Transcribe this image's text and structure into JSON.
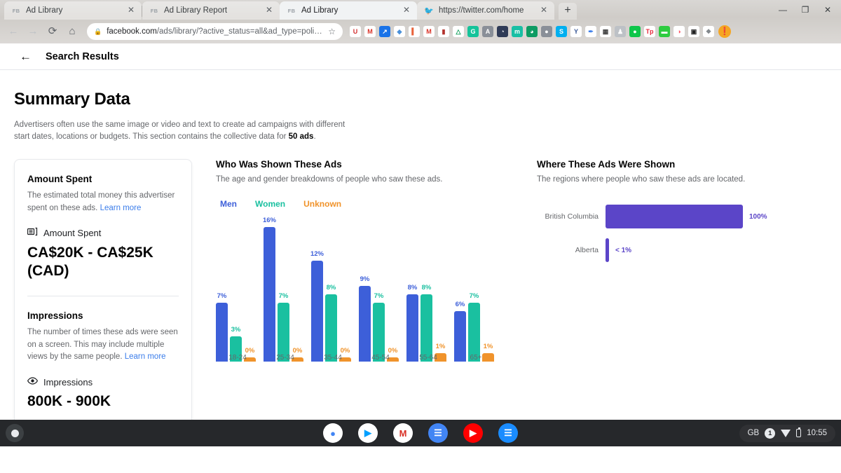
{
  "browser": {
    "tabs": [
      {
        "favicon": "fb-icon",
        "title": "Ad Library",
        "active": false
      },
      {
        "favicon": "fb-icon",
        "title": "Ad Library Report",
        "active": false
      },
      {
        "favicon": "fb-icon",
        "title": "Ad Library",
        "active": true
      },
      {
        "favicon": "twitter-icon",
        "title": "https://twitter.com/home",
        "active": false
      }
    ],
    "new_tab_label": "+",
    "close_label": "✕",
    "window_controls": [
      "—",
      "❐",
      "✕"
    ],
    "nav": {
      "back": "←",
      "forward": "→",
      "reload": "⟳",
      "home": "⌂"
    },
    "omnibox": {
      "lock": "🔒",
      "url_domain": "facebook.com",
      "url_path": "/ads/library/?active_status=all&ad_type=politic…",
      "star": "☆"
    },
    "bookmarks": [
      {
        "name": "magnet-icon",
        "glyph": "U",
        "bg": "#ffffff",
        "fg": "#d32f2f"
      },
      {
        "name": "gmail-alt-icon",
        "glyph": "M",
        "bg": "#ffffff",
        "fg": "#d93025"
      },
      {
        "name": "blue-arrow-icon",
        "glyph": "↗",
        "bg": "#1a73e8",
        "fg": "#ffffff"
      },
      {
        "name": "diamond-icon",
        "glyph": "◆",
        "bg": "#ffffff",
        "fg": "#4a90d9"
      },
      {
        "name": "red-book-icon",
        "glyph": "▍",
        "bg": "#ffffff",
        "fg": "#e8623a"
      },
      {
        "name": "gmail-icon",
        "glyph": "M",
        "bg": "#ffffff",
        "fg": "#d93025"
      },
      {
        "name": "dictionary-icon",
        "glyph": "▮",
        "bg": "#ffffff",
        "fg": "#b3322c"
      },
      {
        "name": "google-drive-icon",
        "glyph": "△",
        "bg": "#ffffff",
        "fg": "#0f9d58"
      },
      {
        "name": "grammarly-icon",
        "glyph": "G",
        "bg": "#15c39a",
        "fg": "#ffffff"
      },
      {
        "name": "archive-icon",
        "glyph": "A",
        "bg": "#8a8f98",
        "fg": "#ffffff"
      },
      {
        "name": "moon-icon",
        "glyph": "◔",
        "bg": "#2f3a56",
        "fg": "#ffffff"
      },
      {
        "name": "mix-icon",
        "glyph": "m",
        "bg": "#18bfa4",
        "fg": "#ffffff"
      },
      {
        "name": "clock-icon",
        "glyph": "◕",
        "bg": "#0d9b63",
        "fg": "#ffffff"
      },
      {
        "name": "ghostery-icon",
        "glyph": "●",
        "bg": "#8a8f98",
        "fg": "#ffffff"
      },
      {
        "name": "skype-icon",
        "glyph": "S",
        "bg": "#00aff0",
        "fg": "#ffffff"
      },
      {
        "name": "yandex-icon",
        "glyph": "Y",
        "bg": "#ffffff",
        "fg": "#3b5998"
      },
      {
        "name": "eyedropper-icon",
        "glyph": "✒",
        "bg": "#ffffff",
        "fg": "#3b7dea"
      },
      {
        "name": "news-icon",
        "glyph": "▦",
        "bg": "#ffffff",
        "fg": "#444444"
      },
      {
        "name": "walk-icon",
        "glyph": "♟",
        "bg": "#bdc1c6",
        "fg": "#ffffff"
      },
      {
        "name": "flame-icon",
        "glyph": "●",
        "bg": "#0ec64a",
        "fg": "#ffffff"
      },
      {
        "name": "toronto-star-icon",
        "glyph": "Tp",
        "bg": "#ffffff",
        "fg": "#e8253a"
      },
      {
        "name": "pill-icon",
        "glyph": "▬",
        "bg": "#2ecc40",
        "fg": "#ffffff"
      },
      {
        "name": "ad-icon",
        "glyph": "◑",
        "bg": "#ffffff",
        "fg": "#ff5566"
      },
      {
        "name": "pip-icon",
        "glyph": "▣",
        "bg": "#ffffff",
        "fg": "#222222"
      },
      {
        "name": "extensions-icon",
        "glyph": "❖",
        "bg": "#ffffff",
        "fg": "#80868b"
      }
    ],
    "profile_initial": "❗"
  },
  "page_header": {
    "back_label": "←",
    "title": "Search Results"
  },
  "summary": {
    "title": "Summary Data",
    "description_part1": "Advertisers often use the same image or video and text to create ad campaigns with different start dates, locations or budgets. This section contains the collective data for ",
    "ads_count": "50 ads",
    "description_part2": "."
  },
  "amount_card": {
    "heading": "Amount Spent",
    "description": "The estimated total money this advertiser spent on these ads.",
    "learn_more": "Learn more",
    "metric_icon": "money-stack-icon",
    "metric_name": "Amount Spent",
    "metric_value": "CA$20K - CA$25K (CAD)",
    "impressions_heading": "Impressions",
    "impressions_description": "The number of times these ads were seen on a screen. This may include multiple views by the same people.",
    "impressions_learn_more": "Learn more",
    "impressions_icon": "eye-icon",
    "impressions_metric_name": "Impressions",
    "impressions_value": "800K - 900K"
  },
  "gender_panel": {
    "heading": "Who Was Shown These Ads",
    "subheading": "The age and gender breakdowns of people who saw these ads."
  },
  "region_panel": {
    "heading": "Where These Ads Were Shown",
    "subheading": "The regions where people who saw these ads are located."
  },
  "colors": {
    "men": "#3d5fd9",
    "women": "#1ac0a0",
    "unknown": "#f0932b",
    "region": "#5b45c8",
    "link": "#3b7dea"
  },
  "chart_data": [
    {
      "type": "bar",
      "title": "Who Was Shown These Ads",
      "subtitle": "The age and gender breakdowns of people who saw these ads.",
      "xlabel": "",
      "ylabel": "",
      "ylim": [
        0,
        16
      ],
      "grid": false,
      "legend_position": "top-left",
      "categories": [
        "18-24",
        "25-34",
        "35-44",
        "45-54",
        "55-64",
        "65+"
      ],
      "series": [
        {
          "name": "Men",
          "color": "#3d5fd9",
          "values": [
            7,
            16,
            12,
            9,
            8,
            6
          ],
          "labels": [
            "7%",
            "16%",
            "12%",
            "9%",
            "8%",
            "6%"
          ]
        },
        {
          "name": "Women",
          "color": "#1ac0a0",
          "values": [
            3,
            7,
            8,
            7,
            8,
            7
          ],
          "labels": [
            "3%",
            "7%",
            "8%",
            "7%",
            "8%",
            "7%"
          ]
        },
        {
          "name": "Unknown",
          "color": "#f0932b",
          "values": [
            0,
            0,
            0,
            0,
            1,
            1
          ],
          "labels": [
            "0%",
            "0%",
            "0%",
            "0%",
            "1%",
            "1%"
          ]
        }
      ]
    },
    {
      "type": "bar",
      "orientation": "horizontal",
      "title": "Where These Ads Were Shown",
      "subtitle": "The regions where people who saw these ads are located.",
      "xlabel": "",
      "ylabel": "",
      "xlim": [
        0,
        100
      ],
      "grid": false,
      "categories": [
        "British Columbia",
        "Alberta"
      ],
      "values": [
        100,
        0.4
      ],
      "labels": [
        "100%",
        "< 1%"
      ],
      "color": "#5b45c8"
    }
  ],
  "taskbar": {
    "launcher_name": "launcher-button",
    "apps": [
      {
        "name": "chrome-icon",
        "glyph": "●",
        "bg": "#ffffff",
        "fg": "#4285f4"
      },
      {
        "name": "play-store-icon",
        "glyph": "▶",
        "bg": "#ffffff",
        "fg": "#00a0ff"
      },
      {
        "name": "gmail-icon",
        "glyph": "M",
        "bg": "#ffffff",
        "fg": "#d93025"
      },
      {
        "name": "docs-icon",
        "glyph": "☰",
        "bg": "#4285f4",
        "fg": "#ffffff"
      },
      {
        "name": "youtube-icon",
        "glyph": "▶",
        "bg": "#ff0000",
        "fg": "#ffffff"
      },
      {
        "name": "messages-icon",
        "glyph": "☰",
        "bg": "#1a8cff",
        "fg": "#ffffff"
      }
    ],
    "status": {
      "locale": "GB",
      "notification_count": "1",
      "wifi_icon": "wifi-icon",
      "battery_icon": "battery-icon",
      "time": "10:55"
    }
  }
}
